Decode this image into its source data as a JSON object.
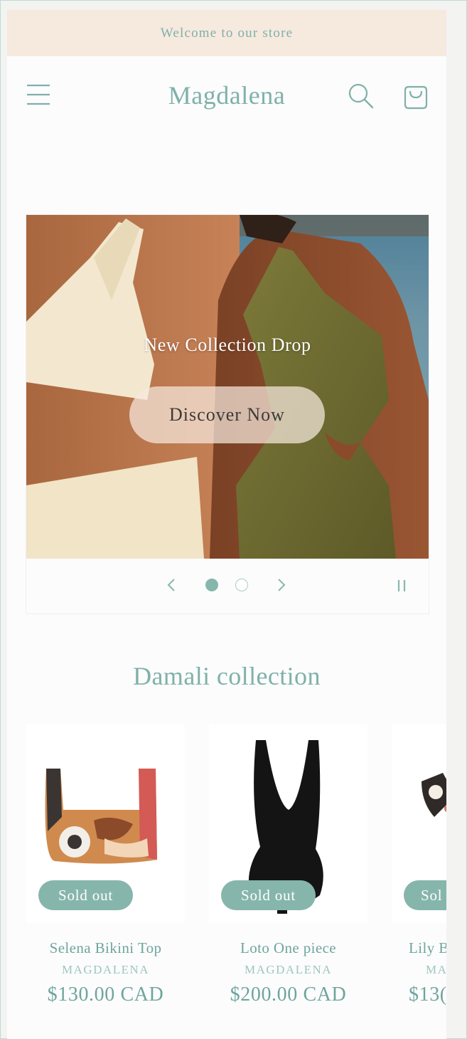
{
  "announcement": {
    "text": "Welcome to our store"
  },
  "header": {
    "logo": "Magdalena",
    "menu_icon": "hamburger-menu-icon",
    "search_icon": "search-icon",
    "cart_icon": "cart-icon"
  },
  "hero": {
    "heading": "New Collection Drop",
    "button_label": "Discover Now",
    "slides": {
      "current": 1,
      "total": 2
    },
    "controls": {
      "prev_icon": "chevron-left-icon",
      "next_icon": "chevron-right-icon",
      "pause_icon": "pause-icon"
    }
  },
  "collection": {
    "title": "Damali collection",
    "products": [
      {
        "name": "Selena Bikini Top",
        "vendor": "MAGDALENA",
        "price": "$130.00 CAD",
        "badge": "Sold out"
      },
      {
        "name": "Loto One piece",
        "vendor": "MAGDALENA",
        "price": "$200.00 CAD",
        "badge": "Sold out"
      },
      {
        "name": "Lily B",
        "vendor": "MA",
        "price": "$13(",
        "badge": "Sol"
      }
    ]
  },
  "colors": {
    "accent": "#7fb1aa",
    "badge": "#86b5ac",
    "announcement_bg": "#f6e9de"
  }
}
